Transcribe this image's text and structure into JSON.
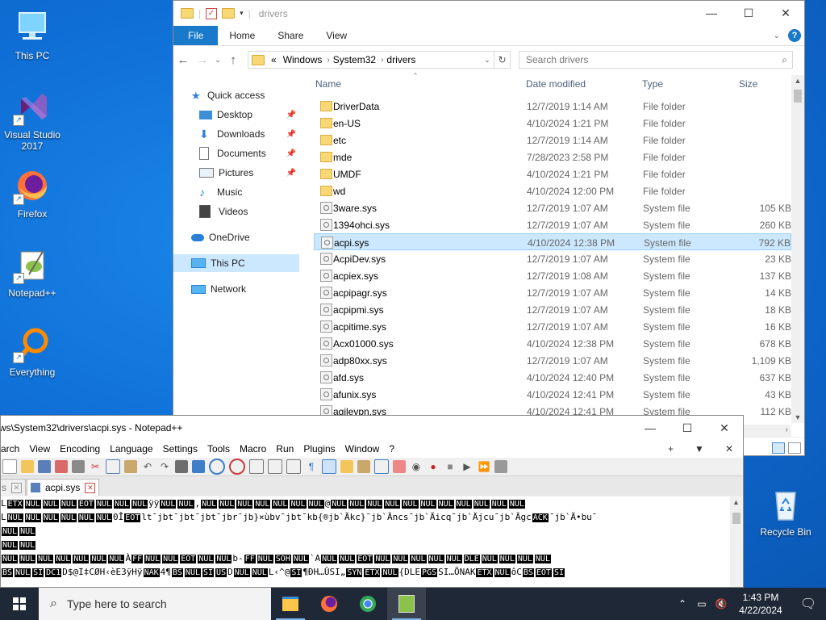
{
  "desktop": {
    "icons": [
      {
        "label": "This PC"
      },
      {
        "label": "Visual Studio\n2017"
      },
      {
        "label": "Firefox"
      },
      {
        "label": "Notepad++"
      },
      {
        "label": "Everything"
      },
      {
        "label": "Recycle Bin"
      }
    ]
  },
  "explorer": {
    "title": "drivers",
    "ribbon": {
      "file": "File",
      "home": "Home",
      "share": "Share",
      "view": "View"
    },
    "address": {
      "lead": "«",
      "crumbs": [
        "Windows",
        "System32",
        "drivers"
      ]
    },
    "search_placeholder": "Search drivers",
    "nav": {
      "quick_access": "Quick access",
      "desktop": "Desktop",
      "downloads": "Downloads",
      "documents": "Documents",
      "pictures": "Pictures",
      "music": "Music",
      "videos": "Videos",
      "onedrive": "OneDrive",
      "this_pc": "This PC",
      "network": "Network"
    },
    "columns": {
      "name": "Name",
      "date": "Date modified",
      "type": "Type",
      "size": "Size"
    },
    "rows": [
      {
        "name": "DriverData",
        "date": "12/7/2019 1:14 AM",
        "type": "File folder",
        "size": "",
        "kind": "folder"
      },
      {
        "name": "en-US",
        "date": "4/10/2024 1:21 PM",
        "type": "File folder",
        "size": "",
        "kind": "folder"
      },
      {
        "name": "etc",
        "date": "12/7/2019 1:14 AM",
        "type": "File folder",
        "size": "",
        "kind": "folder"
      },
      {
        "name": "mde",
        "date": "7/28/2023 2:58 PM",
        "type": "File folder",
        "size": "",
        "kind": "folder"
      },
      {
        "name": "UMDF",
        "date": "4/10/2024 1:21 PM",
        "type": "File folder",
        "size": "",
        "kind": "folder"
      },
      {
        "name": "wd",
        "date": "4/10/2024 12:00 PM",
        "type": "File folder",
        "size": "",
        "kind": "folder"
      },
      {
        "name": "3ware.sys",
        "date": "12/7/2019 1:07 AM",
        "type": "System file",
        "size": "105 KB",
        "kind": "sys"
      },
      {
        "name": "1394ohci.sys",
        "date": "12/7/2019 1:07 AM",
        "type": "System file",
        "size": "260 KB",
        "kind": "sys"
      },
      {
        "name": "acpi.sys",
        "date": "4/10/2024 12:38 PM",
        "type": "System file",
        "size": "792 KB",
        "kind": "sys",
        "selected": true
      },
      {
        "name": "AcpiDev.sys",
        "date": "12/7/2019 1:07 AM",
        "type": "System file",
        "size": "23 KB",
        "kind": "sys"
      },
      {
        "name": "acpiex.sys",
        "date": "12/7/2019 1:08 AM",
        "type": "System file",
        "size": "137 KB",
        "kind": "sys"
      },
      {
        "name": "acpipagr.sys",
        "date": "12/7/2019 1:07 AM",
        "type": "System file",
        "size": "14 KB",
        "kind": "sys"
      },
      {
        "name": "acpipmi.sys",
        "date": "12/7/2019 1:07 AM",
        "type": "System file",
        "size": "18 KB",
        "kind": "sys"
      },
      {
        "name": "acpitime.sys",
        "date": "12/7/2019 1:07 AM",
        "type": "System file",
        "size": "16 KB",
        "kind": "sys"
      },
      {
        "name": "Acx01000.sys",
        "date": "4/10/2024 12:38 PM",
        "type": "System file",
        "size": "678 KB",
        "kind": "sys"
      },
      {
        "name": "adp80xx.sys",
        "date": "12/7/2019 1:07 AM",
        "type": "System file",
        "size": "1,109 KB",
        "kind": "sys"
      },
      {
        "name": "afd.sys",
        "date": "4/10/2024 12:40 PM",
        "type": "System file",
        "size": "637 KB",
        "kind": "sys"
      },
      {
        "name": "afunix.sys",
        "date": "4/10/2024 12:41 PM",
        "type": "System file",
        "size": "43 KB",
        "kind": "sys"
      },
      {
        "name": "agilevpn.sys",
        "date": "4/10/2024 12:41 PM",
        "type": "System file",
        "size": "112 KB",
        "kind": "sys"
      }
    ]
  },
  "notepad": {
    "title": "ws\\System32\\drivers\\acpi.sys - Notepad++",
    "menu": [
      "arch",
      "View",
      "Encoding",
      "Language",
      "Settings",
      "Tools",
      "Macro",
      "Run",
      "Plugins",
      "Window",
      "?"
    ],
    "tabs": {
      "prev": "s",
      "active": "acpi.sys"
    },
    "lines": [
      "L ETX NUL NUL NUL EOT NUL NUL NUL ÿÿ NUL NUL , NUL NUL NUL NUL NUL NUL NUL @ NUL NUL NUL NUL NUL NUL NUL NUL NUL NUL NUL",
      "L NUL NUL NUL NUL NUL NUL 0Î EOT lt¯jbt¯jbt¯jbt¯jbr¯jb}×ùbv¯jbt¯kb{®jb`Äkc}¯jb`Äncs¯jb`Äicq¯jb`Äjcu¯jb`Ägc ACK ¯jb`Ä•bu¯",
      "NUL NUL",
      "NUL NUL",
      "NUL NUL NUL NUL NUL NUL NUL À FF NUL NUL EOT NUL NUL b- FF NUL SOH NUL `A NUL NUL EOT NUL NUL NUL NUL NUL DLE NUL NUL NUL NUL",
      "BS NUL SI DC1 D$@I‡CØH‹èE3ÿHÿ NAK 4¶ BS NUL SI US D NUL NUL L‹^@ SI ¶ÐH…ÛSI„ SYN ETX NUL {DLE PGS SI…ÕNAK ETX NUL ôC BS EOT SI"
    ],
    "bold_tokens": [
      "NUL",
      "ETX",
      "EOT",
      "SOH",
      "DLE",
      "FF",
      "BS",
      "SI",
      "DC1",
      "NAK",
      "US",
      "SYN",
      "ACK",
      "PGS"
    ]
  },
  "taskbar": {
    "search_placeholder": "Type here to search",
    "time": "1:43 PM",
    "date": "4/22/2024"
  }
}
